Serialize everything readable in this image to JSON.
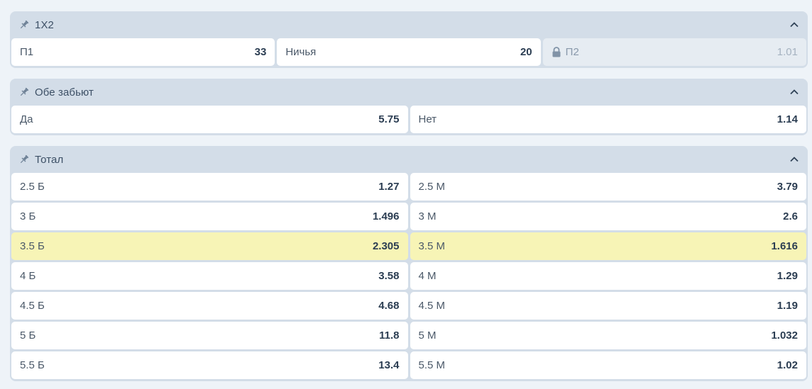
{
  "colors": {
    "header_bg": "#d3dde8",
    "cell_bg": "#ffffff",
    "highlight_bg": "#f7f4b6",
    "locked_bg": "#e6ecf2",
    "text": "#3a4a5e"
  },
  "markets": [
    {
      "title": "1X2",
      "rows": [
        [
          {
            "label": "П1",
            "odds": "33"
          },
          {
            "label": "Ничья",
            "odds": "20"
          },
          {
            "label": "П2",
            "odds": "1.01",
            "locked": true
          }
        ]
      ]
    },
    {
      "title": "Обе забьют",
      "rows": [
        [
          {
            "label": "Да",
            "odds": "5.75"
          },
          {
            "label": "Нет",
            "odds": "1.14"
          }
        ]
      ]
    },
    {
      "title": "Тотал",
      "rows": [
        [
          {
            "label": "2.5 Б",
            "odds": "1.27"
          },
          {
            "label": "2.5 М",
            "odds": "3.79"
          }
        ],
        [
          {
            "label": "3 Б",
            "odds": "1.496"
          },
          {
            "label": "3 М",
            "odds": "2.6"
          }
        ],
        [
          {
            "label": "3.5 Б",
            "odds": "2.305",
            "highlight": true
          },
          {
            "label": "3.5 М",
            "odds": "1.616",
            "highlight": true
          }
        ],
        [
          {
            "label": "4 Б",
            "odds": "3.58"
          },
          {
            "label": "4 М",
            "odds": "1.29"
          }
        ],
        [
          {
            "label": "4.5 Б",
            "odds": "4.68"
          },
          {
            "label": "4.5 М",
            "odds": "1.19"
          }
        ],
        [
          {
            "label": "5 Б",
            "odds": "11.8"
          },
          {
            "label": "5 М",
            "odds": "1.032"
          }
        ],
        [
          {
            "label": "5.5 Б",
            "odds": "13.4"
          },
          {
            "label": "5.5 М",
            "odds": "1.02"
          }
        ]
      ]
    }
  ]
}
